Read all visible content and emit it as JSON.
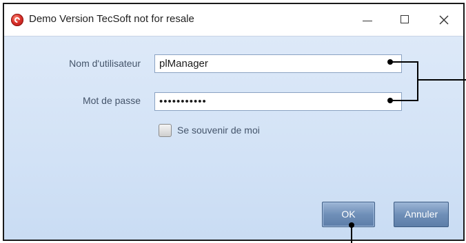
{
  "window": {
    "title": "Demo Version TecSoft not for resale",
    "icon": "app-logo-icon",
    "controls": [
      "minimize-icon",
      "maximize-icon",
      "close-icon"
    ]
  },
  "form": {
    "username_label": "Nom d'utilisateur",
    "username_value": "plManager",
    "password_label": "Mot de passe",
    "password_value": "•••••••••••",
    "remember_label": "Se souvenir de moi",
    "remember_checked": false
  },
  "buttons": {
    "ok_label": "OK",
    "cancel_label": "Annuler"
  },
  "colors": {
    "client_background": "#d6e4f7",
    "button": "#6f8fb8",
    "annotation": "#000000"
  }
}
